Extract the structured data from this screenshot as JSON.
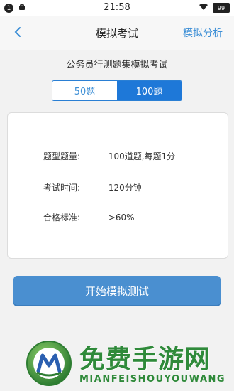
{
  "statusbar": {
    "notification_count": "1",
    "time": "21:58",
    "battery": "99"
  },
  "nav": {
    "title": "模拟考试",
    "right_link": "模拟分析"
  },
  "exam": {
    "name": "公务员行测题集模拟考试"
  },
  "segment": {
    "options": [
      "50题",
      "100题"
    ],
    "selected": "100题"
  },
  "info": {
    "rows": [
      {
        "label": "题型题量:",
        "value": "100道题,每题1分"
      },
      {
        "label": "考试时间:",
        "value": "120分钟"
      },
      {
        "label": "合格标准:",
        "value": ">60%"
      }
    ]
  },
  "start_button": "开始模拟测试",
  "watermark": {
    "title": "免费手游网",
    "subtitle": "MIANFEISHOUYOUWANG"
  }
}
